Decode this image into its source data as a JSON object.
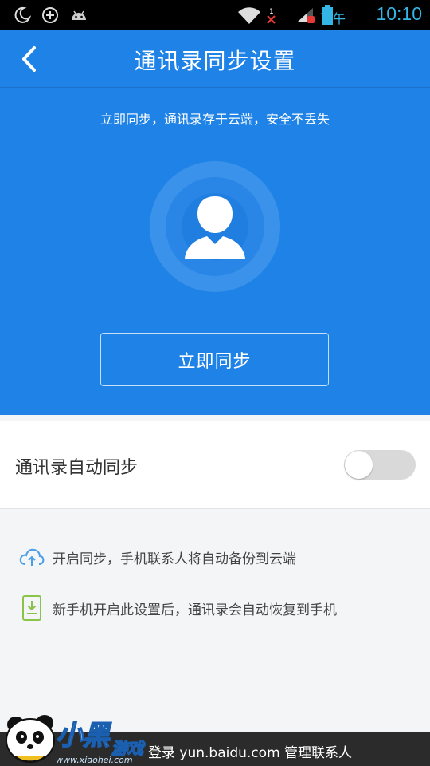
{
  "status_bar": {
    "time": "10:10",
    "ampm": "下午",
    "notification_badge": "1",
    "icons": [
      "moon-icon",
      "add-circle-icon",
      "android-icon",
      "wifi-icon",
      "signal-icon",
      "battery-icon"
    ]
  },
  "header": {
    "title": "通讯录同步设置",
    "back_icon": "chevron-left-icon"
  },
  "hero": {
    "subtitle": "立即同步，通讯录存于云端，安全不丢失",
    "sync_button_label": "立即同步",
    "avatar_icon": "user-silhouette-icon"
  },
  "auto_sync": {
    "label": "通讯录自动同步",
    "enabled": false
  },
  "info": [
    {
      "icon": "cloud-upload-icon",
      "text": "开启同步，手机联系人将自动备份到云端"
    },
    {
      "icon": "phone-download-icon",
      "text": "新手机开启此设置后，通讯录会自动恢复到手机"
    }
  ],
  "bottom_bar": {
    "text": "登录 yun.baidu.com 管理联系人"
  },
  "watermark": {
    "logo_text": "小黑",
    "logo_sub": "游戏",
    "url": "www.xiaohei.com"
  },
  "colors": {
    "primary": "#1e82e6",
    "status_accent": "#33b5e5",
    "background": "#f4f5f7",
    "icon_blue": "#4a9ee8",
    "icon_green": "#8bc34a"
  }
}
